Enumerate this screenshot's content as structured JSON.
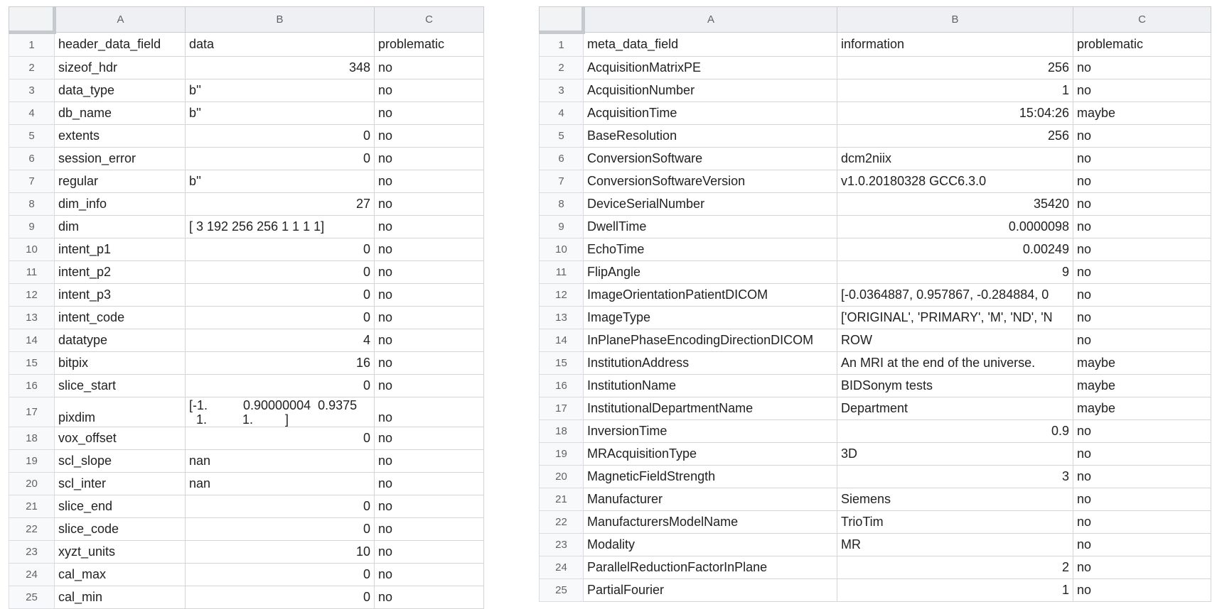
{
  "left_sheet": {
    "columns": [
      "A",
      "B",
      "C"
    ],
    "rows": [
      {
        "n": "1",
        "a": "header_data_field",
        "b": "data",
        "c": "problematic",
        "num": false
      },
      {
        "n": "2",
        "a": "sizeof_hdr",
        "b": "348",
        "c": "no",
        "num": true
      },
      {
        "n": "3",
        "a": "data_type",
        "b": "b''",
        "c": "no",
        "num": false
      },
      {
        "n": "4",
        "a": "db_name",
        "b": "b''",
        "c": "no",
        "num": false
      },
      {
        "n": "5",
        "a": "extents",
        "b": "0",
        "c": "no",
        "num": true
      },
      {
        "n": "6",
        "a": "session_error",
        "b": "0",
        "c": "no",
        "num": true
      },
      {
        "n": "7",
        "a": "regular",
        "b": "b''",
        "c": "no",
        "num": false
      },
      {
        "n": "8",
        "a": "dim_info",
        "b": "27",
        "c": "no",
        "num": true
      },
      {
        "n": "9",
        "a": "dim",
        "b": "[  3 192 256 256   1   1   1   1]",
        "c": "no",
        "num": false
      },
      {
        "n": "10",
        "a": "intent_p1",
        "b": "0",
        "c": "no",
        "num": true
      },
      {
        "n": "11",
        "a": "intent_p2",
        "b": "0",
        "c": "no",
        "num": true
      },
      {
        "n": "12",
        "a": "intent_p3",
        "b": "0",
        "c": "no",
        "num": true
      },
      {
        "n": "13",
        "a": "intent_code",
        "b": "0",
        "c": "no",
        "num": true
      },
      {
        "n": "14",
        "a": "datatype",
        "b": "4",
        "c": "no",
        "num": true
      },
      {
        "n": "15",
        "a": "bitpix",
        "b": "16",
        "c": "no",
        "num": true
      },
      {
        "n": "16",
        "a": "slice_start",
        "b": "0",
        "c": "no",
        "num": true
      },
      {
        "n": "17",
        "a": "pixdim",
        "b": "[-1.          0.90000004  0.9375\n  1.          1.         ]",
        "c": "no",
        "num": false,
        "tall": true
      },
      {
        "n": "18",
        "a": "vox_offset",
        "b": "0",
        "c": "no",
        "num": true
      },
      {
        "n": "19",
        "a": "scl_slope",
        "b": "nan",
        "c": "no",
        "num": false
      },
      {
        "n": "20",
        "a": "scl_inter",
        "b": "nan",
        "c": "no",
        "num": false
      },
      {
        "n": "21",
        "a": "slice_end",
        "b": "0",
        "c": "no",
        "num": true
      },
      {
        "n": "22",
        "a": "slice_code",
        "b": "0",
        "c": "no",
        "num": true
      },
      {
        "n": "23",
        "a": "xyzt_units",
        "b": "10",
        "c": "no",
        "num": true
      },
      {
        "n": "24",
        "a": "cal_max",
        "b": "0",
        "c": "no",
        "num": true
      },
      {
        "n": "25",
        "a": "cal_min",
        "b": "0",
        "c": "no",
        "num": true
      }
    ]
  },
  "right_sheet": {
    "columns": [
      "A",
      "B",
      "C"
    ],
    "rows": [
      {
        "n": "1",
        "a": "meta_data_field",
        "b": "information",
        "c": "problematic",
        "num": false
      },
      {
        "n": "2",
        "a": "AcquisitionMatrixPE",
        "b": "256",
        "c": "no",
        "num": true
      },
      {
        "n": "3",
        "a": "AcquisitionNumber",
        "b": "1",
        "c": "no",
        "num": true
      },
      {
        "n": "4",
        "a": "AcquisitionTime",
        "b": "15:04:26",
        "c": "maybe",
        "num": true
      },
      {
        "n": "5",
        "a": "BaseResolution",
        "b": "256",
        "c": "no",
        "num": true
      },
      {
        "n": "6",
        "a": "ConversionSoftware",
        "b": "dcm2niix",
        "c": "no",
        "num": false
      },
      {
        "n": "7",
        "a": "ConversionSoftwareVersion",
        "b": "v1.0.20180328 GCC6.3.0",
        "c": "no",
        "num": false
      },
      {
        "n": "8",
        "a": "DeviceSerialNumber",
        "b": "35420",
        "c": "no",
        "num": true
      },
      {
        "n": "9",
        "a": "DwellTime",
        "b": "0.0000098",
        "c": "no",
        "num": true
      },
      {
        "n": "10",
        "a": "EchoTime",
        "b": "0.00249",
        "c": "no",
        "num": true
      },
      {
        "n": "11",
        "a": "FlipAngle",
        "b": "9",
        "c": "no",
        "num": true
      },
      {
        "n": "12",
        "a": "ImageOrientationPatientDICOM",
        "b": "[-0.0364887, 0.957867, -0.284884, 0",
        "c": "no",
        "num": false
      },
      {
        "n": "13",
        "a": "ImageType",
        "b": "['ORIGINAL', 'PRIMARY', 'M', 'ND', 'N",
        "c": "no",
        "num": false
      },
      {
        "n": "14",
        "a": "InPlanePhaseEncodingDirectionDICOM",
        "b": "ROW",
        "c": "no",
        "num": false
      },
      {
        "n": "15",
        "a": "InstitutionAddress",
        "b": "An MRI at the end of the universe.",
        "c": "maybe",
        "num": false
      },
      {
        "n": "16",
        "a": "InstitutionName",
        "b": "BIDSonym tests",
        "c": "maybe",
        "num": false
      },
      {
        "n": "17",
        "a": "InstitutionalDepartmentName",
        "b": "Department",
        "c": "maybe",
        "num": false
      },
      {
        "n": "18",
        "a": "InversionTime",
        "b": "0.9",
        "c": "no",
        "num": true
      },
      {
        "n": "19",
        "a": "MRAcquisitionType",
        "b": "3D",
        "c": "no",
        "num": false
      },
      {
        "n": "20",
        "a": "MagneticFieldStrength",
        "b": "3",
        "c": "no",
        "num": true
      },
      {
        "n": "21",
        "a": "Manufacturer",
        "b": "Siemens",
        "c": "no",
        "num": false
      },
      {
        "n": "22",
        "a": "ManufacturersModelName",
        "b": "TrioTim",
        "c": "no",
        "num": false
      },
      {
        "n": "23",
        "a": "Modality",
        "b": "MR",
        "c": "no",
        "num": false
      },
      {
        "n": "24",
        "a": "ParallelReductionFactorInPlane",
        "b": "2",
        "c": "no",
        "num": true
      },
      {
        "n": "25",
        "a": "PartialFourier",
        "b": "1",
        "c": "no",
        "num": true
      }
    ]
  }
}
